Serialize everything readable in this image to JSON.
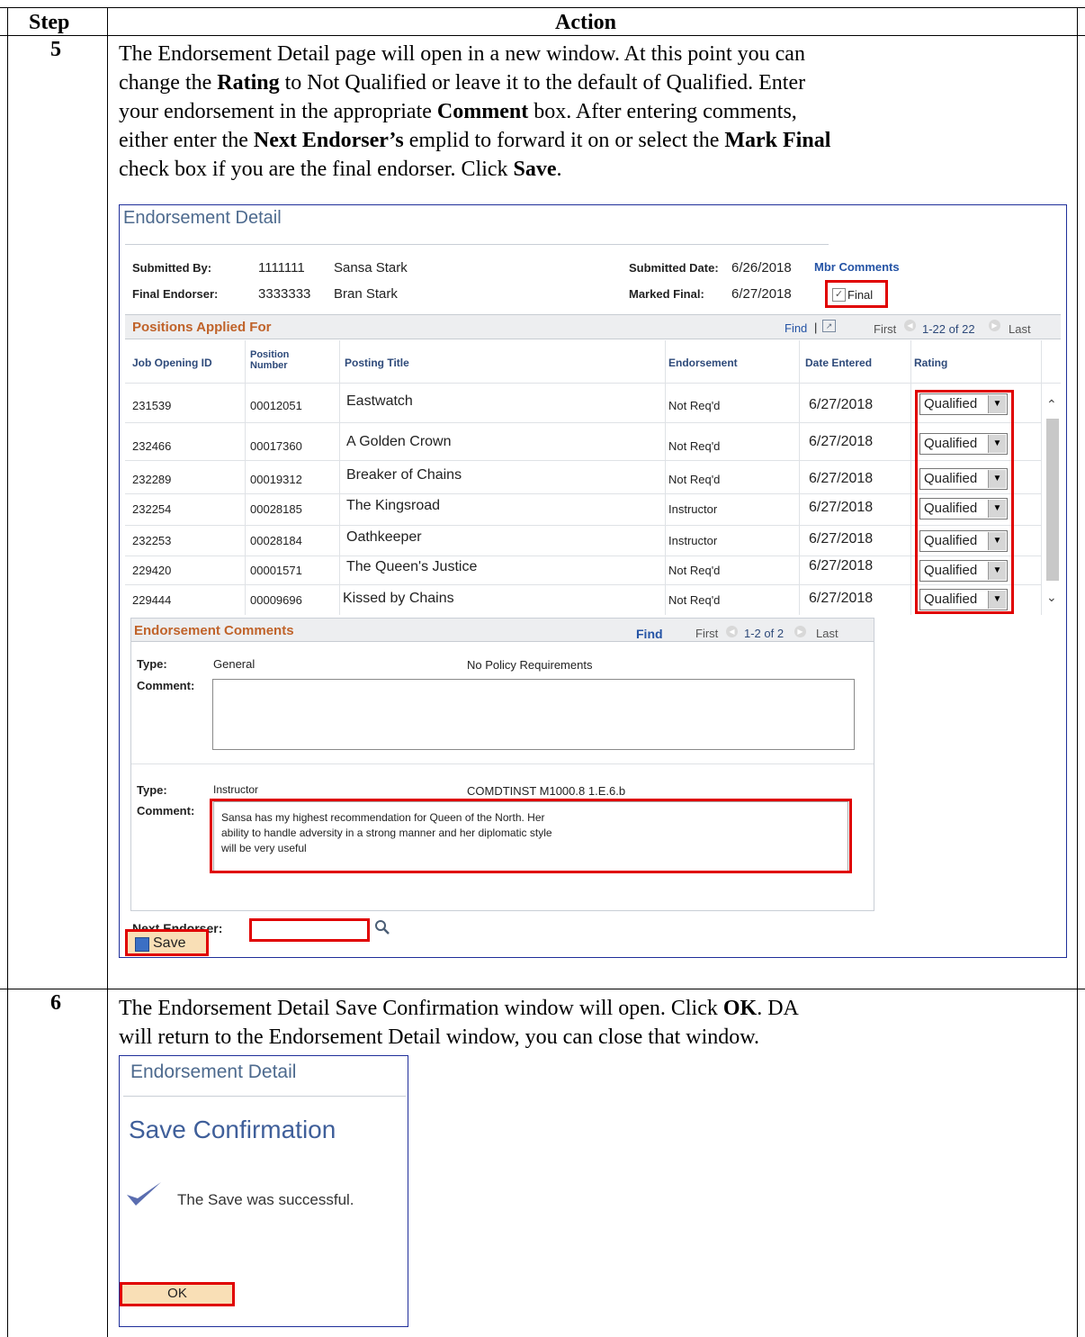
{
  "table": {
    "header": {
      "step": "Step",
      "action": "Action"
    },
    "steps": [
      {
        "number": "5",
        "paragraph": {
          "line1": "The Endorsement Detail page will open in a new window. At this point you can",
          "line2_a": "change the ",
          "line2_b": "Rating",
          "line2_c": " to Not Qualified or leave it to the default of Qualified. Enter",
          "line3_a": "your endorsement in the appropriate ",
          "line3_b": "Comment",
          "line3_c": " box. After entering comments,",
          "line4_a": "either enter the ",
          "line4_b": "Next Endorser’s",
          "line4_c": " emplid to forward it on or select the ",
          "line4_d": "Mark Final",
          "line5_a": "check box if you are the final endorser. Click ",
          "line5_b": "Save",
          "line5_c": "."
        }
      },
      {
        "number": "6",
        "paragraph": {
          "line1_a": "The Endorsement Detail Save Confirmation window will open. Click ",
          "line1_b": "OK",
          "line1_c": ". DA",
          "line2": "will return to the Endorsement Detail window, you can close that window."
        }
      }
    ]
  },
  "endorsement_detail": {
    "title": "Endorsement Detail",
    "submitted_by_label": "Submitted By:",
    "submitted_by_id": "1111111",
    "submitted_by_name": "Sansa Stark",
    "final_endorser_label": "Final Endorser:",
    "final_endorser_id": "3333333",
    "final_endorser_name": "Bran Stark",
    "submitted_date_label": "Submitted Date:",
    "submitted_date": "6/26/2018",
    "mbr_comments_link": "Mbr Comments",
    "marked_final_label": "Marked Final:",
    "marked_final_date": "6/27/2018",
    "final_checkbox_label": "Final",
    "final_checked": true,
    "positions": {
      "title": "Positions Applied For",
      "find": "Find",
      "sep": "|",
      "first": "First",
      "range": "1-22 of 22",
      "last": "Last",
      "columns": [
        "Job Opening ID",
        "Position",
        "Number",
        "Posting Title",
        "Endorsement",
        "Date Entered",
        "Rating"
      ],
      "rows": [
        {
          "job_id": "231539",
          "position": "00012051",
          "title": "Eastwatch",
          "endorsement": "Not Req'd",
          "date": "6/27/2018",
          "rating": "Qualified"
        },
        {
          "job_id": "232466",
          "position": "00017360",
          "title": "A Golden Crown",
          "endorsement": "Not Req'd",
          "date": "6/27/2018",
          "rating": "Qualified"
        },
        {
          "job_id": "232289",
          "position": "00019312",
          "title": "Breaker of Chains",
          "endorsement": "Not Req'd",
          "date": "6/27/2018",
          "rating": "Qualified"
        },
        {
          "job_id": "232254",
          "position": "00028185",
          "title": "The Kingsroad",
          "endorsement": "Instructor",
          "date": "6/27/2018",
          "rating": "Qualified"
        },
        {
          "job_id": "232253",
          "position": "00028184",
          "title": "Oathkeeper",
          "endorsement": "Instructor",
          "date": "6/27/2018",
          "rating": "Qualified"
        },
        {
          "job_id": "229420",
          "position": "00001571",
          "title": "The Queen's Justice",
          "endorsement": "Not Req'd",
          "date": "6/27/2018",
          "rating": "Qualified"
        },
        {
          "job_id": "229444",
          "position": "00009696",
          "title": "Kissed by Chains",
          "endorsement": "Not Req'd",
          "date": "6/27/2018",
          "rating": "Qualified"
        }
      ]
    },
    "comments": {
      "title": "Endorsement Comments",
      "find": "Find",
      "first": "First",
      "range": "1-2 of 2",
      "last": "Last",
      "type_label": "Type:",
      "comment_label": "Comment:",
      "entries": [
        {
          "type": "General",
          "policy": "No Policy Requirements",
          "comment_line1": "",
          "comment_line2": "",
          "comment_line3": ""
        },
        {
          "type": "Instructor",
          "policy": "COMDTINST M1000.8 1.E.6.b",
          "comment_line1": "Sansa has my highest recommendation for Queen of the North. Her",
          "comment_line2": "ability to handle adversity in a strong manner and her diplomatic style",
          "comment_line3": "will be very useful"
        }
      ]
    },
    "next_endorser_label": "Next Endorser:",
    "next_endorser_value": "",
    "save_label": "Save"
  },
  "save_confirmation": {
    "title": "Endorsement Detail",
    "heading": "Save Confirmation",
    "message": "The Save was successful.",
    "ok_label": "OK"
  },
  "colors": {
    "highlight": "#e00000",
    "border_blue": "#1f2f9a",
    "title": "#4d6a8e",
    "link": "#2453a5",
    "grid_title": "#c0632a"
  }
}
